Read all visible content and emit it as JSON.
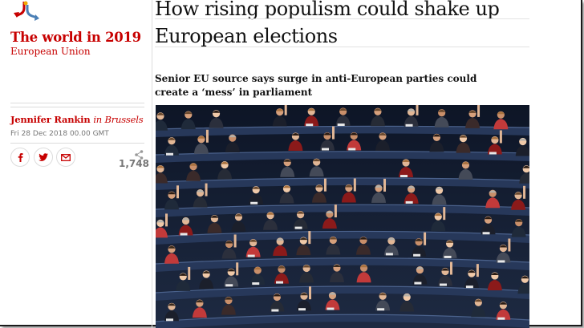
{
  "series": {
    "title": "The world in 2019",
    "subtitle": "European Union",
    "logo_icon": "series-arrows-icon"
  },
  "article": {
    "headline": "How rising populism could shake up European elections",
    "headline_lines": [
      "How rising populism could shake up",
      "European elections"
    ],
    "standfirst": "Senior EU source says surge in anti-European parties could create a ‘mess’ in parliament",
    "byline_author": "Jennifer Rankin",
    "byline_location": "in Brussels",
    "date": "Fri 28 Dec 2018 00.00 GMT",
    "main_image": "European Parliament chamber with members voting"
  },
  "share": {
    "buttons": [
      {
        "name": "facebook",
        "icon": "facebook-icon"
      },
      {
        "name": "twitter",
        "icon": "twitter-icon"
      },
      {
        "name": "email",
        "icon": "email-icon"
      }
    ],
    "count": "1,748",
    "count_icon": "share-icon"
  },
  "colors": {
    "accent": "#c70000",
    "text": "#121212",
    "muted": "#767676",
    "rule": "#dcdcdc"
  }
}
